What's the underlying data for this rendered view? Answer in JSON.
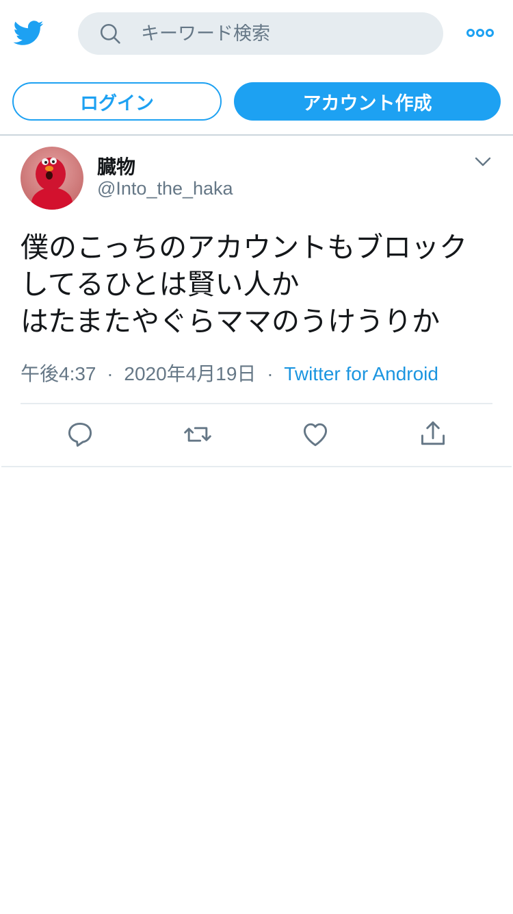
{
  "header": {
    "logo_icon": "twitter-bird-icon",
    "search_placeholder": "キーワード検索",
    "more_icon": "more-dots-icon"
  },
  "auth": {
    "login_label": "ログイン",
    "signup_label": "アカウント作成"
  },
  "tweet": {
    "display_name": "臓物",
    "handle": "@Into_the_haka",
    "text": "僕のこっちのアカウントもブロックしてるひとは賢い人か\nはたまたやぐらママのうけうりか",
    "time": "午後4:37",
    "date": "2020年4月19日",
    "source": "Twitter for Android",
    "separator": "·"
  },
  "actions": [
    "reply-icon",
    "retweet-icon",
    "like-icon",
    "share-icon"
  ],
  "colors": {
    "brand": "#1da1f2",
    "link": "#1b95e0",
    "text_primary": "#14171a",
    "text_secondary": "#657786",
    "search_bg": "#e6ecf0",
    "divider": "#e6ecf0"
  }
}
